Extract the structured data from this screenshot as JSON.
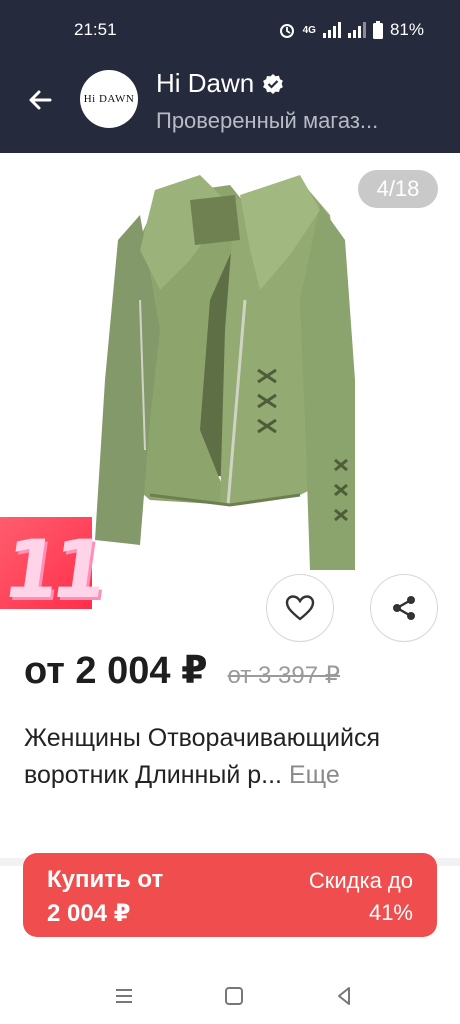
{
  "status_bar": {
    "time": "21:51",
    "network": "4G",
    "battery": "81%"
  },
  "header": {
    "shop_logo_text": "Hi DAWN",
    "shop_name": "Hi Dawn",
    "shop_subtitle": "Проверенный магаз..."
  },
  "gallery": {
    "counter": "4/18",
    "badge_text": "11"
  },
  "product": {
    "price": "от 2 004 ₽",
    "old_price": "от 3 397 ₽",
    "title": "Женщины Отворачивающийся воротник Длинный р...",
    "more_label": "Еще"
  },
  "buy_button": {
    "line1": "Купить от",
    "line2": "2 004 ₽",
    "discount_line1": "Скидка до",
    "discount_line2": "41%"
  },
  "colors": {
    "header_bg": "#262a3d",
    "accent_red": "#f04e4e",
    "jacket_green": "#8da46c"
  }
}
